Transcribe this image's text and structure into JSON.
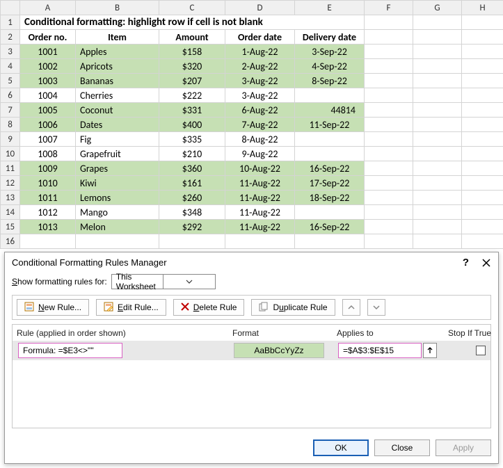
{
  "columns": [
    "A",
    "B",
    "C",
    "D",
    "E",
    "F",
    "G",
    "H"
  ],
  "title": "Conditional formatting: highlight row if cell is not blank",
  "headers": {
    "order": "Order no.",
    "item": "Item",
    "amount": "Amount",
    "orderdate": "Order date",
    "delivery": "Delivery date"
  },
  "rows": [
    {
      "n": "3",
      "hl": true,
      "order": "1001",
      "item": "Apples",
      "amount": "$158",
      "orderdate": "1-Aug-22",
      "delivery": "3-Sep-22"
    },
    {
      "n": "4",
      "hl": true,
      "order": "1002",
      "item": "Apricots",
      "amount": "$320",
      "orderdate": "2-Aug-22",
      "delivery": "4-Sep-22"
    },
    {
      "n": "5",
      "hl": true,
      "order": "1003",
      "item": "Bananas",
      "amount": "$207",
      "orderdate": "3-Aug-22",
      "delivery": "8-Sep-22"
    },
    {
      "n": "6",
      "hl": false,
      "order": "1004",
      "item": "Cherries",
      "amount": "$222",
      "orderdate": "3-Aug-22",
      "delivery": ""
    },
    {
      "n": "7",
      "hl": true,
      "order": "1005",
      "item": "Coconut",
      "amount": "$331",
      "orderdate": "6-Aug-22",
      "delivery": "44814"
    },
    {
      "n": "8",
      "hl": true,
      "order": "1006",
      "item": "Dates",
      "amount": "$400",
      "orderdate": "7-Aug-22",
      "delivery": "11-Sep-22"
    },
    {
      "n": "9",
      "hl": false,
      "order": "1007",
      "item": "Fig",
      "amount": "$335",
      "orderdate": "8-Aug-22",
      "delivery": ""
    },
    {
      "n": "10",
      "hl": false,
      "order": "1008",
      "item": "Grapefruit",
      "amount": "$210",
      "orderdate": "9-Aug-22",
      "delivery": ""
    },
    {
      "n": "11",
      "hl": true,
      "order": "1009",
      "item": "Grapes",
      "amount": "$360",
      "orderdate": "10-Aug-22",
      "delivery": "16-Sep-22"
    },
    {
      "n": "12",
      "hl": true,
      "order": "1010",
      "item": "Kiwi",
      "amount": "$161",
      "orderdate": "11-Aug-22",
      "delivery": "17-Sep-22"
    },
    {
      "n": "13",
      "hl": true,
      "order": "1011",
      "item": "Lemons",
      "amount": "$260",
      "orderdate": "11-Aug-22",
      "delivery": "18-Sep-22"
    },
    {
      "n": "14",
      "hl": false,
      "order": "1012",
      "item": "Mango",
      "amount": "$348",
      "orderdate": "11-Aug-22",
      "delivery": ""
    },
    {
      "n": "15",
      "hl": true,
      "order": "1013",
      "item": "Melon",
      "amount": "$292",
      "orderdate": "11-Aug-22",
      "delivery": "16-Sep-22"
    }
  ],
  "dialog": {
    "title": "Conditional Formatting Rules Manager",
    "show_label_pre": "S",
    "show_label_post": "how formatting rules for:",
    "scope": "This Worksheet",
    "buttons": {
      "new_pre": "",
      "new_ul": "N",
      "new_post": "ew Rule...",
      "edit_pre": "",
      "edit_ul": "E",
      "edit_post": "dit Rule...",
      "del_pre": "",
      "del_ul": "D",
      "del_post": "elete Rule",
      "dup_pre": "D",
      "dup_ul": "u",
      "dup_post": "plicate Rule"
    },
    "cols": {
      "rule": "Rule (applied in order shown)",
      "format": "Format",
      "applies": "Applies to",
      "stop": "Stop If True"
    },
    "rule": {
      "label": "Formula: =$E3<>\"\"",
      "sample": "AaBbCcYyZz",
      "applies": "=$A$3:$E$15"
    },
    "footer": {
      "ok": "OK",
      "close": "Close",
      "apply": "Apply"
    }
  }
}
